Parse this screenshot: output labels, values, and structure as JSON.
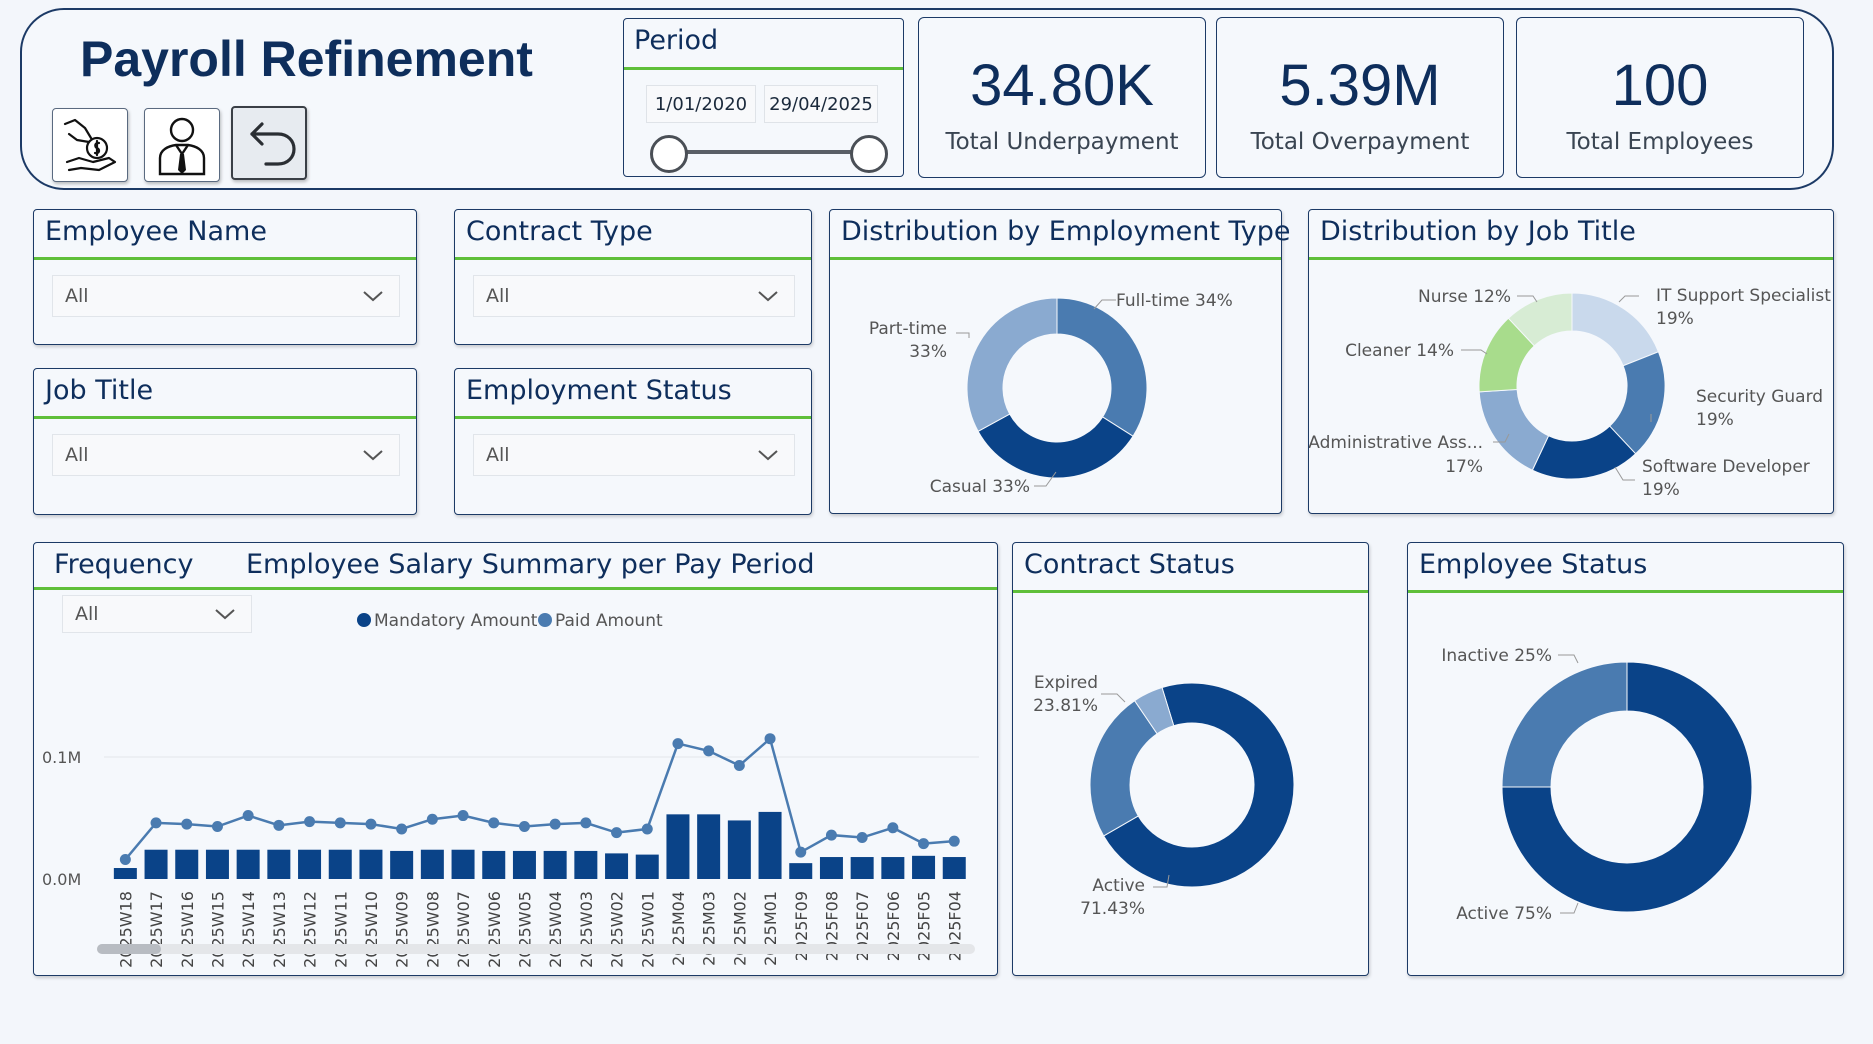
{
  "header": {
    "title": "Payroll Refinement",
    "nav_buttons": [
      {
        "icon": "hand-money-icon"
      },
      {
        "icon": "employee-person-icon"
      },
      {
        "icon": "back-arrow-icon"
      }
    ]
  },
  "period": {
    "label": "Period",
    "start": "1/01/2020",
    "end": "29/04/2025"
  },
  "kpis": [
    {
      "value": "34.80K",
      "caption": "Total Underpayment"
    },
    {
      "value": "5.39M",
      "caption": "Total Overpayment"
    },
    {
      "value": "100",
      "caption": "Total Employees"
    }
  ],
  "filters": {
    "employee_name": {
      "title": "Employee Name",
      "value": "All"
    },
    "contract_type": {
      "title": "Contract Type",
      "value": "All"
    },
    "job_title": {
      "title": "Job Title",
      "value": "All"
    },
    "employment_status": {
      "title": "Employment Status",
      "value": "All"
    }
  },
  "frequency": {
    "title": "Frequency",
    "value": "All"
  },
  "colors": {
    "dark_blue": "#0a4388",
    "mid_blue": "#4a7bb0",
    "light_blue": "#8aaad0",
    "pale_blue": "#c9d9ec",
    "green": "#5fbf3a",
    "light_green": "#a8dc8c",
    "pale_green": "#d7ecd4"
  },
  "chart_data": [
    {
      "type": "pie",
      "title": "Distribution by Employment Type",
      "slices": [
        {
          "label": "Full-time",
          "pct_label": "34%",
          "value": 34,
          "color": "#4a7bb0"
        },
        {
          "label": "Casual",
          "pct_label": "33%",
          "value": 33,
          "color": "#0a4388"
        },
        {
          "label": "Part-time",
          "pct_label": "33%",
          "value": 33,
          "color": "#8aaad0"
        }
      ]
    },
    {
      "type": "pie",
      "title": "Distribution by Job Title",
      "slices": [
        {
          "label": "IT Support Specialist",
          "pct_label": "19%",
          "value": 19,
          "color": "#c9d9ec"
        },
        {
          "label": "Security Guard",
          "pct_label": "19%",
          "value": 19,
          "color": "#4a7bb0"
        },
        {
          "label": "Software Developer",
          "pct_label": "19%",
          "value": 19,
          "color": "#0a4388"
        },
        {
          "label": "Administrative Ass...",
          "pct_label": "17%",
          "value": 17,
          "color": "#8aaad0"
        },
        {
          "label": "Cleaner",
          "pct_label": "14%",
          "value": 14,
          "color": "#a8dc8c"
        },
        {
          "label": "Nurse",
          "pct_label": "12%",
          "value": 12,
          "color": "#d7ecd4"
        }
      ]
    },
    {
      "type": "bar",
      "title": "Employee Salary Summary per Pay Period",
      "categories": [
        "2025W18",
        "2025W17",
        "2025W16",
        "2025W15",
        "2025W14",
        "2025W13",
        "2025W12",
        "2025W11",
        "2025W10",
        "2025W09",
        "2025W08",
        "2025W07",
        "2025W06",
        "2025W05",
        "2025W04",
        "2025W03",
        "2025W02",
        "2025W01",
        "2025M04",
        "2025M03",
        "2025M02",
        "2025M01",
        "2025F09",
        "2025F08",
        "2025F07",
        "2025F06",
        "2025F05",
        "2025F04"
      ],
      "series": [
        {
          "name": "Mandatory Amount",
          "type": "bar",
          "color": "#0a4388",
          "values": [
            0.009,
            0.024,
            0.024,
            0.024,
            0.024,
            0.024,
            0.024,
            0.024,
            0.024,
            0.023,
            0.024,
            0.024,
            0.023,
            0.023,
            0.023,
            0.023,
            0.021,
            0.02,
            0.053,
            0.053,
            0.048,
            0.055,
            0.013,
            0.018,
            0.018,
            0.018,
            0.019,
            0.018
          ]
        },
        {
          "name": "Paid Amount",
          "type": "line",
          "color": "#4a7bb0",
          "values": [
            0.016,
            0.046,
            0.045,
            0.043,
            0.052,
            0.044,
            0.047,
            0.046,
            0.045,
            0.041,
            0.049,
            0.052,
            0.046,
            0.043,
            0.045,
            0.046,
            0.038,
            0.041,
            0.111,
            0.105,
            0.093,
            0.115,
            0.022,
            0.036,
            0.034,
            0.042,
            0.029,
            0.031
          ]
        }
      ],
      "ytick_labels": [
        "0.0M",
        "0.1M"
      ],
      "yticks": [
        0,
        0.1
      ],
      "ylim": [
        0,
        0.1
      ]
    },
    {
      "type": "pie",
      "title": "Contract Status",
      "slices": [
        {
          "label": "Active",
          "pct_label": "71.43%",
          "value": 71.43,
          "color": "#0a4388"
        },
        {
          "label": "Expired",
          "pct_label": "23.81%",
          "value": 23.81,
          "color": "#4a7bb0"
        },
        {
          "label": "",
          "pct_label": "",
          "value": 4.76,
          "color": "#8aaad0"
        }
      ]
    },
    {
      "type": "pie",
      "title": "Employee Status",
      "slices": [
        {
          "label": "Active",
          "pct_label": "75%",
          "value": 75,
          "color": "#0a4388"
        },
        {
          "label": "Inactive",
          "pct_label": "25%",
          "value": 25,
          "color": "#4a7bb0"
        }
      ]
    }
  ]
}
